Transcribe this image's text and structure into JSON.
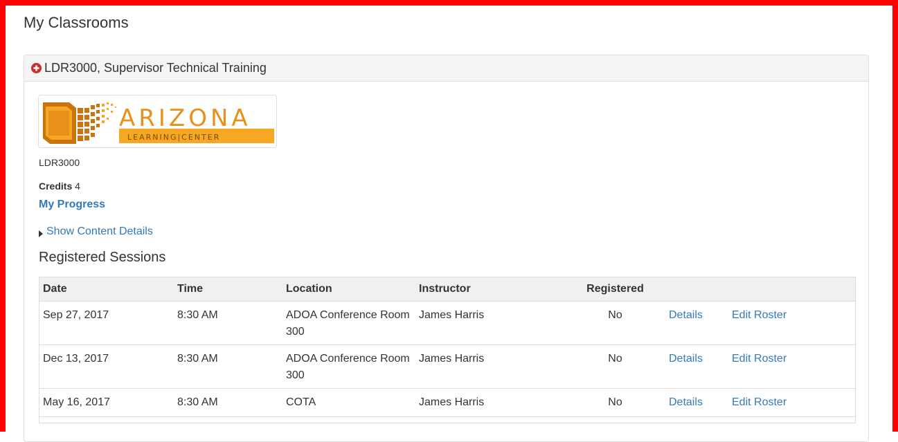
{
  "page": {
    "title": "My Classrooms"
  },
  "panel": {
    "title": "LDR3000, Supervisor Technical Training",
    "expand_icon": "plus-circle-icon"
  },
  "logo": {
    "word": "ARIZONA",
    "sub": "LEARNING|CENTER"
  },
  "course": {
    "code": "LDR3000",
    "credits_label": "Credits",
    "credits_value": "4",
    "progress_link": "My Progress",
    "content_toggle": "Show Content Details"
  },
  "sessions": {
    "title": "Registered Sessions",
    "columns": [
      "Date",
      "Time",
      "Location",
      "Instructor",
      "Registered",
      "",
      ""
    ],
    "rows": [
      {
        "date": "Sep 27, 2017",
        "time": "8:30 AM",
        "location": "ADOA Conference Room 300",
        "instructor": "James Harris",
        "registered": "No",
        "details": "Details",
        "edit": "Edit Roster"
      },
      {
        "date": "Dec 13, 2017",
        "time": "8:30 AM",
        "location": "ADOA Conference Room 300",
        "instructor": "James Harris",
        "registered": "No",
        "details": "Details",
        "edit": "Edit Roster"
      },
      {
        "date": "May 16, 2017",
        "time": "8:30 AM",
        "location": "COTA",
        "instructor": "James Harris",
        "registered": "No",
        "details": "Details",
        "edit": "Edit Roster"
      }
    ]
  },
  "colors": {
    "frame": "#ff0000",
    "link": "#337ab7",
    "logo_orange": "#f7a823",
    "logo_brown": "#c9740f"
  }
}
